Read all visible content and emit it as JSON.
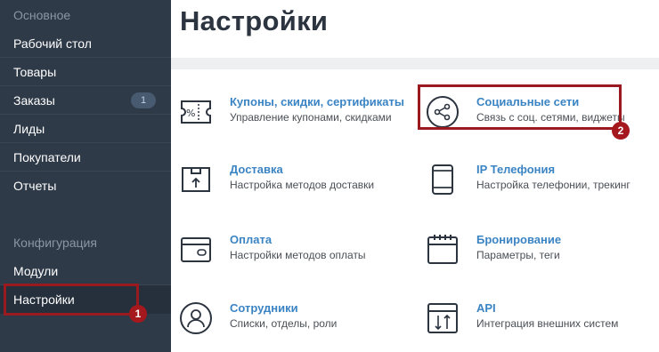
{
  "sidebar": {
    "section_main": "Основное",
    "items": [
      {
        "label": "Рабочий стол"
      },
      {
        "label": "Товары"
      },
      {
        "label": "Заказы",
        "badge": "1"
      },
      {
        "label": "Лиды"
      },
      {
        "label": "Покупатели"
      },
      {
        "label": "Отчеты"
      }
    ],
    "section_config": "Конфигурация",
    "config_items": [
      {
        "label": "Модули"
      },
      {
        "label": "Настройки"
      }
    ]
  },
  "main": {
    "title": "Настройки",
    "cards": [
      {
        "icon": "coupon-icon",
        "title": "Купоны, скидки, сертификаты",
        "desc": "Управление купонами, скидками"
      },
      {
        "icon": "share-icon",
        "title": "Социальные сети",
        "desc": "Связь с соц. сетями, виджеты"
      },
      {
        "icon": "delivery-box-icon",
        "title": "Доставка",
        "desc": "Настройка методов доставки"
      },
      {
        "icon": "phone-icon",
        "title": "IP Телефония",
        "desc": "Настройка телефонии, трекинг"
      },
      {
        "icon": "payment-card-icon",
        "title": "Оплата",
        "desc": "Настройки методов оплаты"
      },
      {
        "icon": "calendar-icon",
        "title": "Бронирование",
        "desc": "Параметры, теги"
      },
      {
        "icon": "user-icon",
        "title": "Сотрудники",
        "desc": "Списки, отделы, роли"
      },
      {
        "icon": "api-icon",
        "title": "API",
        "desc": "Интеграция внешних систем"
      }
    ]
  },
  "annotations": {
    "marker_1": "1",
    "marker_2": "2",
    "highlight_color": "#9b1a1f"
  },
  "colors": {
    "sidebar_bg": "#2f3a48",
    "link": "#3b84c4",
    "title": "#2c3440"
  }
}
